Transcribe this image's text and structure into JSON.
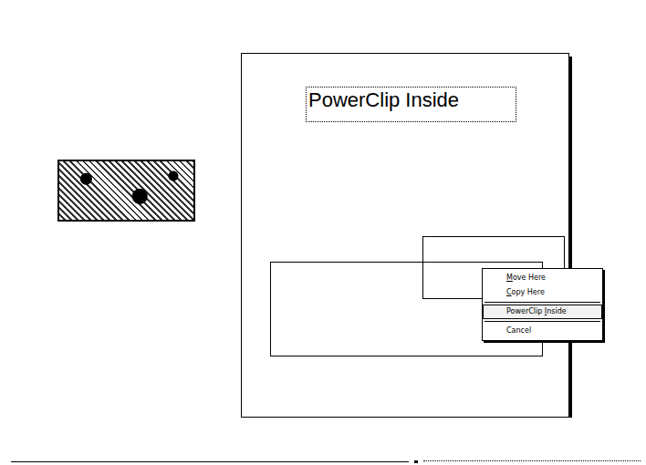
{
  "canvas": {
    "text_object": "PowerClip Inside",
    "photo": {
      "selected": false
    }
  },
  "context_menu": {
    "items": [
      {
        "kind": "item",
        "label": "Move Here",
        "underline": 0,
        "selected": false
      },
      {
        "kind": "item",
        "label": "Copy Here",
        "underline": 0,
        "selected": false
      },
      {
        "kind": "separator",
        "label": "",
        "underline": -1,
        "selected": false
      },
      {
        "kind": "item",
        "label": "PowerClip Inside",
        "underline": 10,
        "selected": true
      },
      {
        "kind": "separator",
        "label": "",
        "underline": -1,
        "selected": false
      },
      {
        "kind": "item",
        "label": "Cancel",
        "underline": -1,
        "selected": false
      }
    ]
  }
}
